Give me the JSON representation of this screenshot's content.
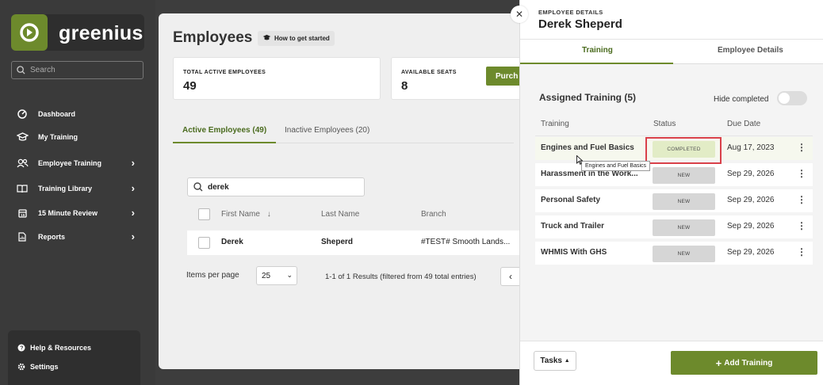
{
  "brand": {
    "name": "greenius",
    "accent": "#6d8a2c"
  },
  "sidebar": {
    "search_placeholder": "Search",
    "items": [
      {
        "label": "Dashboard",
        "icon": "dashboard-icon"
      },
      {
        "label": "My Training",
        "icon": "graduation-cap-icon"
      },
      {
        "label": "Employee Training",
        "icon": "users-icon"
      },
      {
        "label": "Training Library",
        "icon": "book-icon"
      },
      {
        "label": "15 Minute Review",
        "icon": "calendar-icon"
      },
      {
        "label": "Reports",
        "icon": "report-icon"
      }
    ],
    "bottom": [
      {
        "label": "Help & Resources",
        "icon": "help-icon"
      },
      {
        "label": "Settings",
        "icon": "gear-icon"
      }
    ]
  },
  "main": {
    "title": "Employees",
    "how_to": "How to get started",
    "stats": [
      {
        "label": "TOTAL ACTIVE EMPLOYEES",
        "value": "49"
      },
      {
        "label": "AVAILABLE SEATS",
        "value": "8"
      }
    ],
    "purchase_label": "Purch",
    "tabs": [
      {
        "label": "Active Employees (49)"
      },
      {
        "label": "Inactive Employees (20)"
      }
    ],
    "search_value": "derek",
    "columns": [
      "First Name",
      "Last Name",
      "Branch"
    ],
    "rows": [
      {
        "first": "Derek",
        "last": "Sheperd",
        "branch": "#TEST# Smooth Lands..."
      }
    ],
    "items_per_page_label": "Items per page",
    "items_per_page": "25",
    "results": "1-1 of 1 Results (filtered from 49 total entries)"
  },
  "drawer": {
    "subtitle": "EMPLOYEE DETAILS",
    "title": "Derek Sheperd",
    "tabs": [
      "Training",
      "Employee Details"
    ],
    "assigned": "Assigned Training (5)",
    "hide_completed": "Hide completed",
    "columns": [
      "Training",
      "Status",
      "Due Date"
    ],
    "rows": [
      {
        "name": "Engines and Fuel Basics",
        "status": "COMPLETED",
        "due": "Aug 17, 2023"
      },
      {
        "name": "Harassment in the Work...",
        "status": "NEW",
        "due": "Sep 29, 2026"
      },
      {
        "name": "Personal Safety",
        "status": "NEW",
        "due": "Sep 29, 2026"
      },
      {
        "name": "Truck and Trailer",
        "status": "NEW",
        "due": "Sep 29, 2026"
      },
      {
        "name": "WHMIS With GHS",
        "status": "NEW",
        "due": "Sep 29, 2026"
      }
    ],
    "tooltip": "Engines and Fuel Basics",
    "tasks": "Tasks",
    "add_training": "Add Training"
  }
}
